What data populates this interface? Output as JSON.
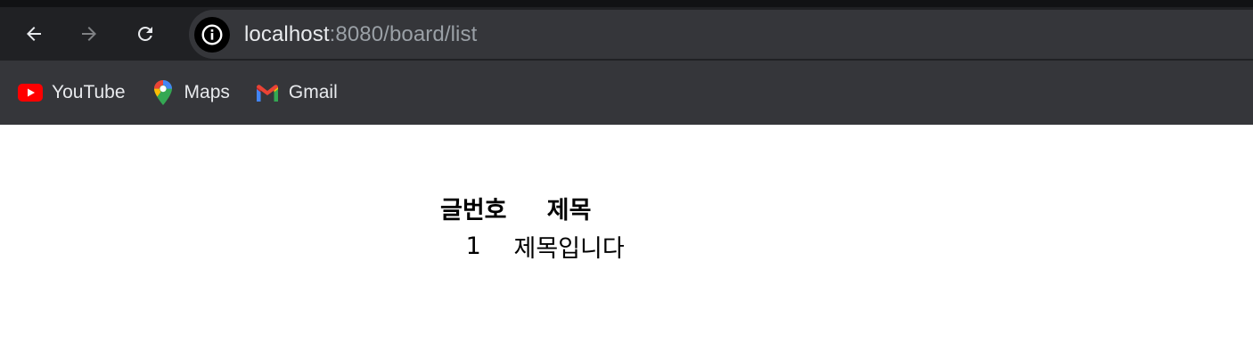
{
  "browser": {
    "url_host": "localhost",
    "url_rest": ":8080/board/list",
    "bookmarks": [
      {
        "label": "YouTube",
        "icon": "youtube-icon"
      },
      {
        "label": "Maps",
        "icon": "maps-icon"
      },
      {
        "label": "Gmail",
        "icon": "gmail-icon"
      }
    ]
  },
  "board": {
    "headers": [
      "글번호",
      "제목"
    ],
    "rows": [
      [
        "1",
        "제목입니다"
      ]
    ]
  }
}
